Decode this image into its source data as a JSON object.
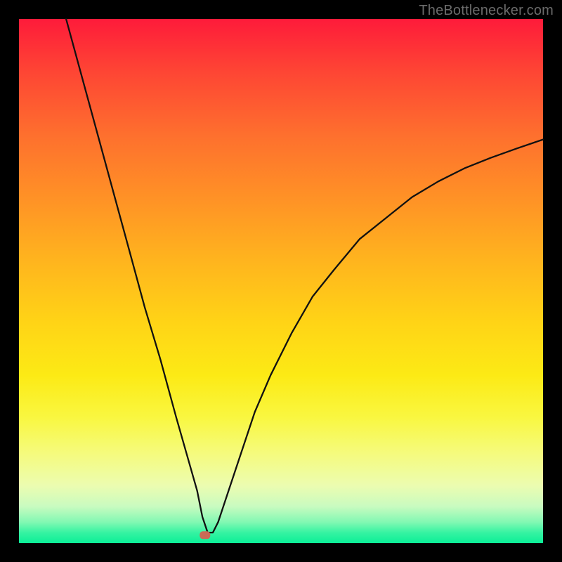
{
  "watermark": "TheBottlenecker.com",
  "chart_data": {
    "type": "line",
    "title": "",
    "xlabel": "",
    "ylabel": "",
    "xlim": [
      0,
      100
    ],
    "ylim": [
      0,
      100
    ],
    "grid": false,
    "legend": false,
    "background_gradient": {
      "top": "#fe1b3a",
      "bottom": "#0bef97"
    },
    "marker": {
      "x": 35.5,
      "y": 1.5,
      "color": "#c96a56"
    },
    "series": [
      {
        "name": "curve",
        "x": [
          9,
          12,
          15,
          18,
          21,
          24,
          27,
          30,
          32,
          34,
          35,
          36,
          37,
          38,
          40,
          42,
          45,
          48,
          52,
          56,
          60,
          65,
          70,
          75,
          80,
          85,
          90,
          95,
          100
        ],
        "y": [
          100,
          89,
          78,
          67,
          56,
          45,
          35,
          24,
          17,
          10,
          5,
          2,
          2,
          4,
          10,
          16,
          25,
          32,
          40,
          47,
          52,
          58,
          62,
          66,
          69,
          71.5,
          73.5,
          75.3,
          77
        ]
      }
    ]
  }
}
